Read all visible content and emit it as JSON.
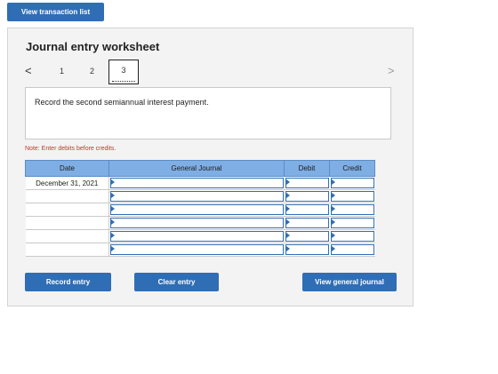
{
  "top": {
    "view_transactions_label": "View transaction list"
  },
  "worksheet": {
    "title": "Journal entry worksheet",
    "pager": {
      "prev": "<",
      "pages": [
        "1",
        "2",
        "3"
      ],
      "current": "3",
      "next": ">"
    },
    "instruction": "Record the second semiannual interest payment.",
    "note": "Note: Enter debits before credits.",
    "table": {
      "headers": {
        "date": "Date",
        "journal": "General Journal",
        "debit": "Debit",
        "credit": "Credit"
      },
      "rows": [
        {
          "date": "December 31, 2021",
          "journal": "",
          "debit": "",
          "credit": ""
        },
        {
          "date": "",
          "journal": "",
          "debit": "",
          "credit": ""
        },
        {
          "date": "",
          "journal": "",
          "debit": "",
          "credit": ""
        },
        {
          "date": "",
          "journal": "",
          "debit": "",
          "credit": ""
        },
        {
          "date": "",
          "journal": "",
          "debit": "",
          "credit": ""
        },
        {
          "date": "",
          "journal": "",
          "debit": "",
          "credit": ""
        }
      ]
    },
    "buttons": {
      "record": "Record entry",
      "clear": "Clear entry",
      "view_general_journal": "View general journal"
    }
  },
  "colors": {
    "button": "#2f6eb5",
    "header": "#7faee4",
    "note": "#c0392b",
    "panel": "#f3f3f3"
  }
}
